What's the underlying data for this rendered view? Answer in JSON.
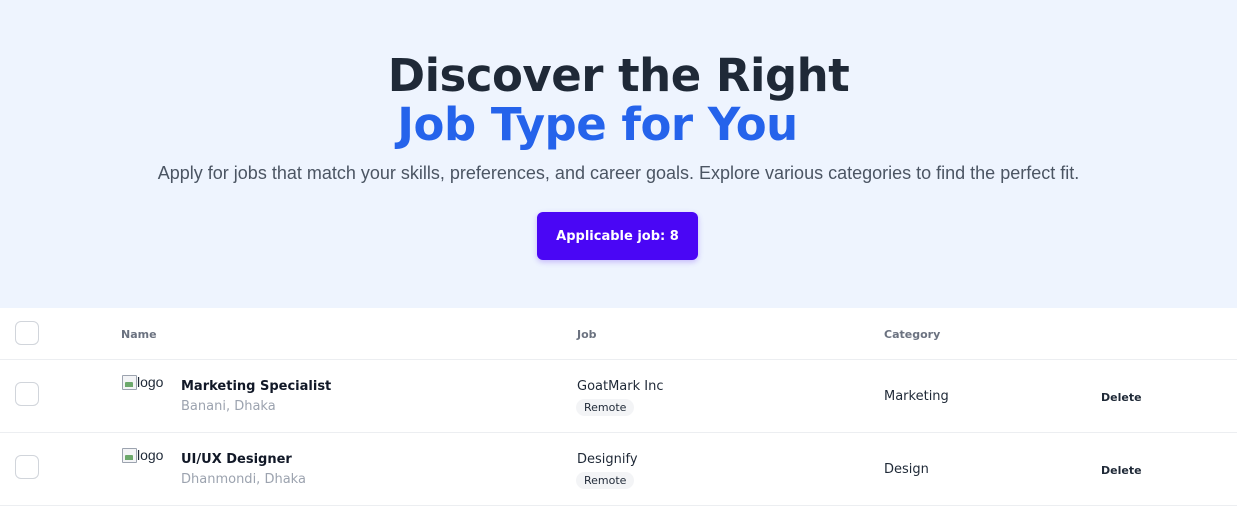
{
  "hero": {
    "title_line1": "Discover the Right",
    "title_line2": "Job Type for You",
    "subtitle": "Apply for jobs that match your skills, preferences, and career goals. Explore various categories to find the perfect fit.",
    "button_label": "Applicable job: 8"
  },
  "colors": {
    "hero_bg": "#eef4fe",
    "accent_blue": "#2563eb",
    "button_purple": "#4a06f5"
  },
  "table": {
    "headers": {
      "name": "Name",
      "job": "Job",
      "category": "Category"
    },
    "rows": [
      {
        "logo_alt": "logo",
        "title": "Marketing Specialist",
        "location": "Banani, Dhaka",
        "company": "GoatMark Inc",
        "work_type": "Remote",
        "category": "Marketing",
        "action": "Delete"
      },
      {
        "logo_alt": "logo",
        "title": "UI/UX Designer",
        "location": "Dhanmondi, Dhaka",
        "company": "Designify",
        "work_type": "Remote",
        "category": "Design",
        "action": "Delete"
      }
    ]
  }
}
